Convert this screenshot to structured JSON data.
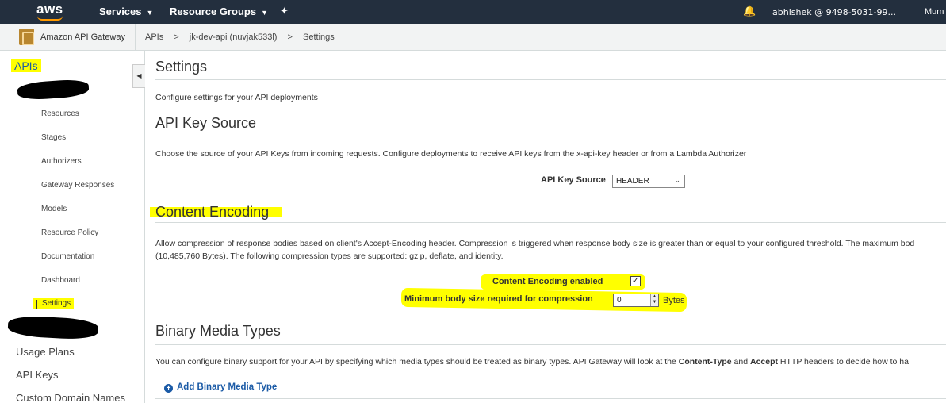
{
  "topnav": {
    "logo": "aws",
    "services_label": "Services",
    "resource_groups_label": "Resource Groups",
    "account": "abhishek @ 9498-5031-99...",
    "region": "Mum"
  },
  "breadcrumb": {
    "service_name": "Amazon API Gateway",
    "items": [
      "APIs",
      ">",
      "jk-dev-api (nuvjak533l)",
      ">",
      "Settings"
    ]
  },
  "sidebar": {
    "title": "APIs",
    "sub_items": [
      "Resources",
      "Stages",
      "Authorizers",
      "Gateway Responses",
      "Models",
      "Resource Policy",
      "Documentation",
      "Dashboard",
      "Settings"
    ],
    "main_items": [
      "Usage Plans",
      "API Keys",
      "Custom Domain Names"
    ]
  },
  "main": {
    "title": "Settings",
    "intro": "Configure settings for your API deployments",
    "api_key_source": {
      "heading": "API Key Source",
      "description": "Choose the source of your API Keys from incoming requests. Configure deployments to receive API keys from the x-api-key header or from a Lambda Authorizer",
      "field_label": "API Key Source",
      "selected": "HEADER"
    },
    "content_encoding": {
      "heading": "Content Encoding",
      "description_line1": "Allow compression of response bodies based on client's Accept-Encoding header. Compression is triggered when response body size is greater than or equal to your configured threshold. The maximum bod",
      "description_line2": "(10,485,760 Bytes). The following compression types are supported: gzip, deflate, and identity.",
      "enabled_label": "Content Encoding enabled",
      "enabled": true,
      "min_size_label": "Minimum body size required for compression",
      "min_size_value": "0",
      "unit": "Bytes"
    },
    "binary_media": {
      "heading": "Binary Media Types",
      "description_pre": "You can configure binary support for your API by specifying which media types should be treated as binary types. API Gateway will look at the ",
      "bold1": "Content-Type",
      "mid": " and ",
      "bold2": "Accept",
      "description_post": " HTTP headers to decide how to ha",
      "add_label": "Add Binary Media Type"
    }
  },
  "colors": {
    "nav_bg": "#232f3e",
    "accent": "#ff9900",
    "link": "#1a5aa6",
    "highlight": "#ffff00"
  }
}
